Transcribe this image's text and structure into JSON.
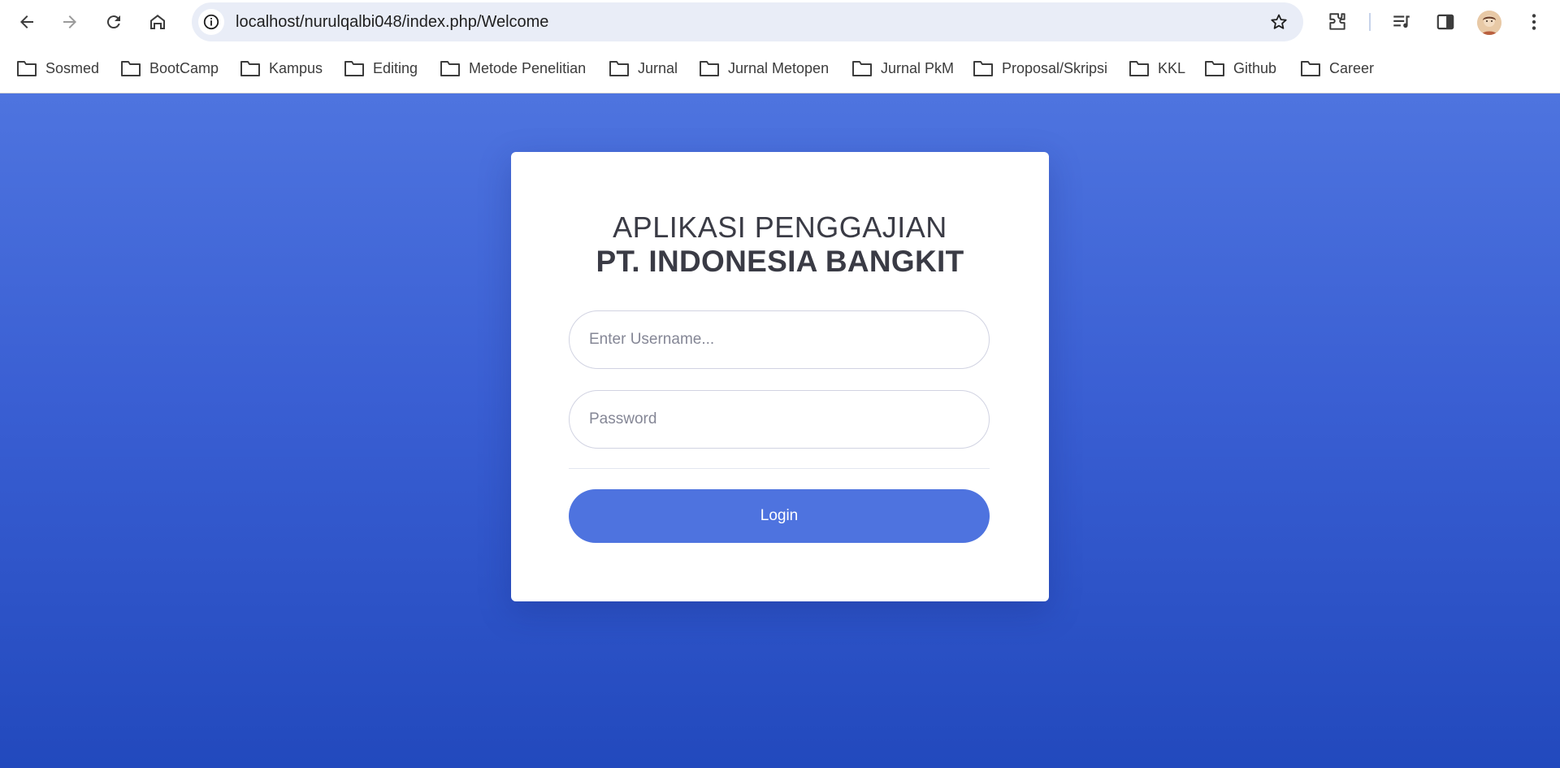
{
  "browser": {
    "url": "localhost/nurulqalbi048/index.php/Welcome",
    "icons": {
      "back": "arrow-left-icon",
      "forward": "arrow-right-icon",
      "reload": "reload-icon",
      "home": "home-icon",
      "site_info": "info-icon",
      "bookmark": "star-icon",
      "extensions": "puzzle-icon",
      "media": "media-queue-icon",
      "side_panel": "side-panel-icon",
      "profile": "avatar",
      "menu": "kebab-menu-icon"
    }
  },
  "bookmarks": [
    {
      "label": "Sosmed"
    },
    {
      "label": "BootCamp"
    },
    {
      "label": "Kampus"
    },
    {
      "label": "Editing"
    },
    {
      "label": "Metode Penelitian"
    },
    {
      "label": "Jurnal"
    },
    {
      "label": "Jurnal Metopen"
    },
    {
      "label": "Jurnal PkM"
    },
    {
      "label": "Proposal/Skripsi"
    },
    {
      "label": "KKL"
    },
    {
      "label": "Github"
    },
    {
      "label": "Career"
    }
  ],
  "login": {
    "title_line1": "APLIKASI PENGGAJIAN",
    "title_line2": "PT. INDONESIA BANGKIT",
    "username": {
      "value": "",
      "placeholder": "Enter Username..."
    },
    "password": {
      "value": "",
      "placeholder": "Password"
    },
    "button_label": "Login"
  },
  "colors": {
    "primary": "#4e73df",
    "gradient_top": "#4e74df",
    "gradient_bottom": "#2249bd",
    "heading": "#3a3b45"
  }
}
